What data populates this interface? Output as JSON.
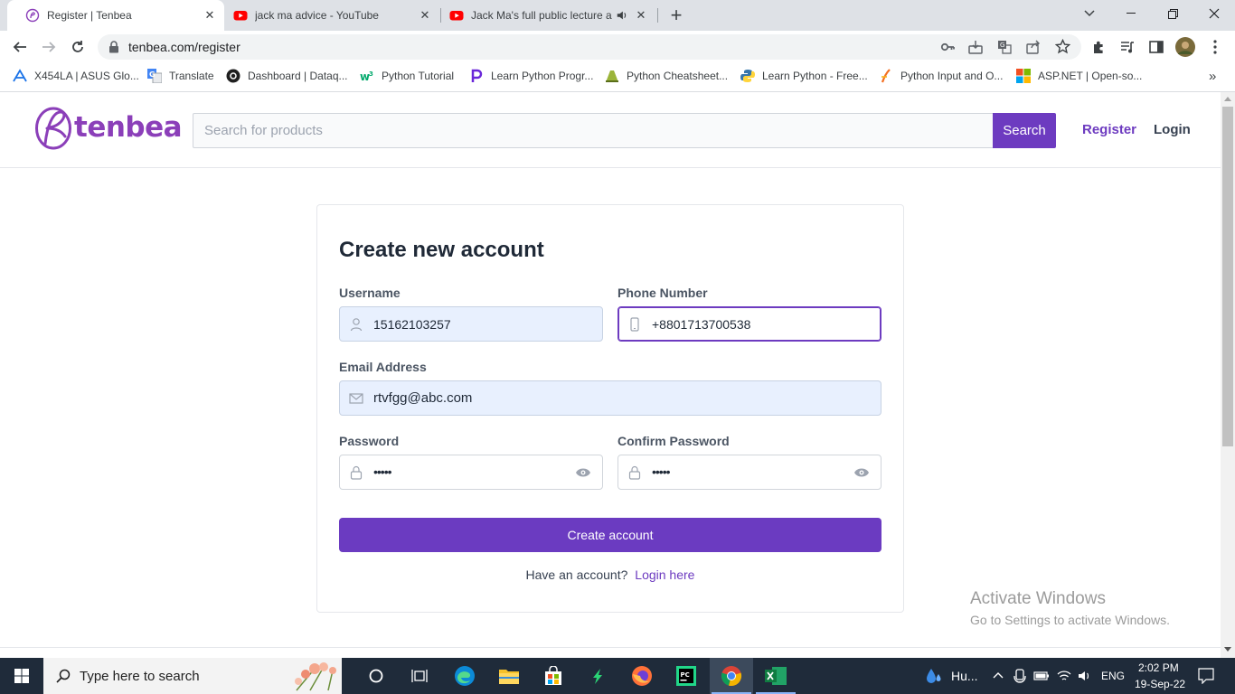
{
  "browser": {
    "tabs": [
      {
        "title": "Register | Tenbea",
        "active": true
      },
      {
        "title": "jack ma advice - YouTube",
        "active": false
      },
      {
        "title": "Jack Ma's full public lecture a",
        "active": false,
        "audio": true
      }
    ],
    "new_tab": "+",
    "url": "tenbea.com/register",
    "bookmarks": [
      {
        "label": "X454LA | ASUS Glo...",
        "icon": "asus-icon"
      },
      {
        "label": "Translate",
        "icon": "translate-icon"
      },
      {
        "label": "Dashboard | Dataq...",
        "icon": "dataquest-icon"
      },
      {
        "label": "Python Tutorial",
        "icon": "w3schools-icon"
      },
      {
        "label": "Learn Python Progr...",
        "icon": "programiz-icon"
      },
      {
        "label": "Python Cheatsheet...",
        "icon": "cheatsheet-icon"
      },
      {
        "label": "Learn Python - Free...",
        "icon": "python-icon"
      },
      {
        "label": "Python Input and O...",
        "icon": "javatpoint-icon"
      },
      {
        "label": "ASP.NET | Open-so...",
        "icon": "microsoft-icon"
      }
    ],
    "bookmarks_overflow": "»"
  },
  "site": {
    "logo_text": "tenbea",
    "search_placeholder": "Search for products",
    "search_button": "Search",
    "nav": {
      "register": "Register",
      "login": "Login"
    },
    "brand_color": "#6d3bc0"
  },
  "form": {
    "title": "Create new account",
    "username": {
      "label": "Username",
      "value": "15162103257"
    },
    "phone": {
      "label": "Phone Number",
      "value": "+8801713700538"
    },
    "email": {
      "label": "Email Address",
      "value": "rtvfgg@abc.com"
    },
    "password": {
      "label": "Password",
      "value": "•••••"
    },
    "confirm_password": {
      "label": "Confirm Password",
      "value": "•••••"
    },
    "submit": "Create account",
    "have_account": "Have an account?",
    "login_link": "Login here"
  },
  "watermark": {
    "line1": "Activate Windows",
    "line2": "Go to Settings to activate Windows."
  },
  "taskbar": {
    "search_placeholder": "Type here to search",
    "weather": "Hu...",
    "language": "ENG",
    "time": "2:02 PM",
    "date": "19-Sep-22"
  }
}
